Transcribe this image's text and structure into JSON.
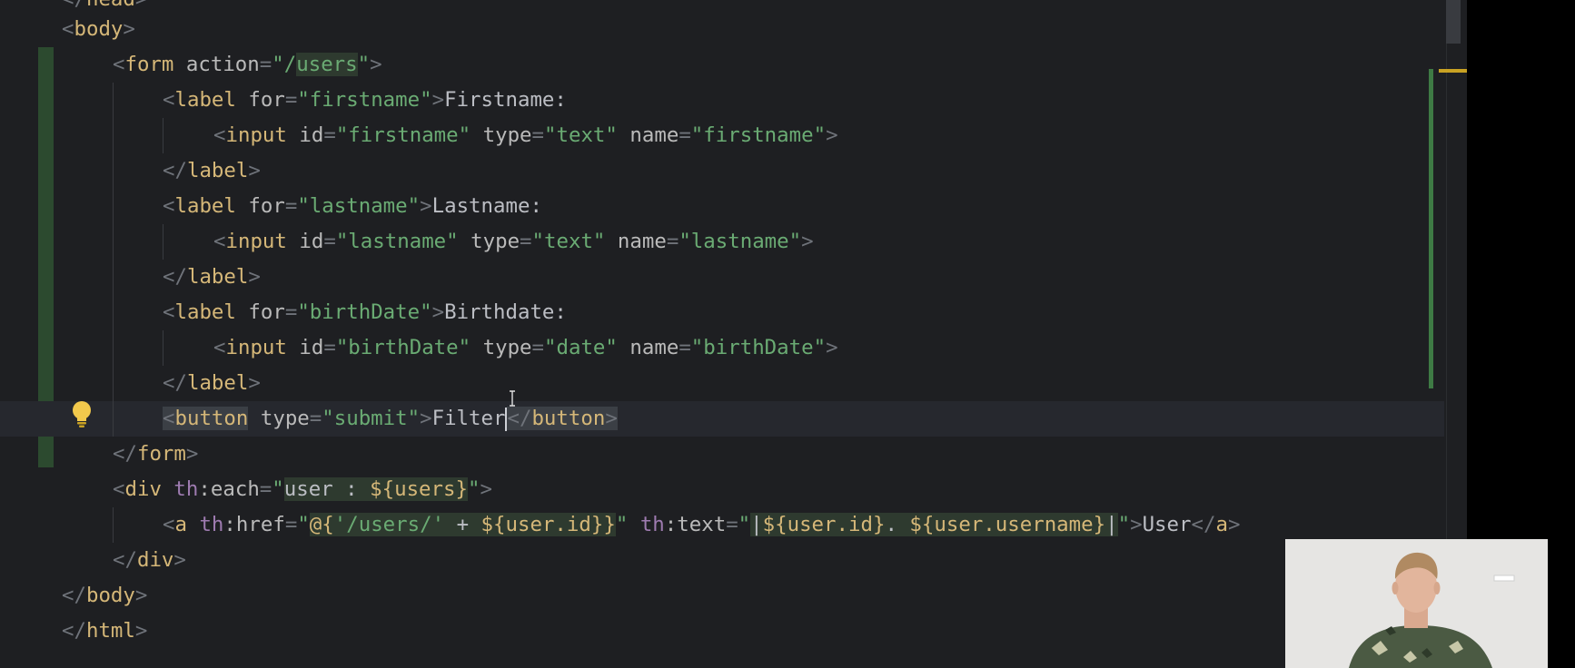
{
  "editor": {
    "language": "HTML (Thymeleaf)",
    "colors": {
      "background": "#1e1f22",
      "tag": "#d5b778",
      "attribute": "#bababa",
      "string": "#6aab73",
      "namespace": "#9e7bb0",
      "modified_gutter": "#2c4a2f",
      "bulb": "#f2c94c"
    },
    "lines": {
      "l0": "</head>",
      "l1_tag": "body",
      "l2": {
        "tag": "form",
        "attr": "action",
        "val_pre": "\"/",
        "val_hl": "users",
        "val_post": "\""
      },
      "l3": {
        "tag": "label",
        "attr": "for",
        "val": "\"firstname\"",
        "text": "Firstname:"
      },
      "l4": {
        "tag": "input",
        "a1": "id",
        "v1": "\"firstname\"",
        "a2": "type",
        "v2": "\"text\"",
        "a3": "name",
        "v3": "\"firstname\""
      },
      "l5_tag": "label",
      "l6": {
        "tag": "label",
        "attr": "for",
        "val": "\"lastname\"",
        "text": "Lastname:"
      },
      "l7": {
        "tag": "input",
        "a1": "id",
        "v1": "\"lastname\"",
        "a2": "type",
        "v2": "\"text\"",
        "a3": "name",
        "v3": "\"lastname\""
      },
      "l8_tag": "label",
      "l9": {
        "tag": "label",
        "attr": "for",
        "val": "\"birthDate\"",
        "text": "Birthdate:"
      },
      "l10": {
        "tag": "input",
        "a1": "id",
        "v1": "\"birthDate\"",
        "a2": "type",
        "v2": "\"date\"",
        "a3": "name",
        "v3": "\"birthDate\""
      },
      "l11_tag": "label",
      "l12": {
        "tag": "button",
        "attr": "type",
        "val": "\"submit\"",
        "text": "Filter",
        "close": "button"
      },
      "l13_tag": "form",
      "l14": {
        "tag": "div",
        "ns": "th",
        "attr": "each",
        "q1": "\"",
        "v_a": "user : ",
        "v_b": "${users}",
        "q2": "\""
      },
      "l15": {
        "tag": "a",
        "ns1": "th",
        "attr1": "href",
        "q1": "\"",
        "h_a": "@{",
        "h_b": "'/users/'",
        "h_c": " + ",
        "h_d": "${user.id}",
        "h_e": "}",
        "q2": "\"",
        "ns2": "th",
        "attr2": "text",
        "q3": "\"",
        "t_a": "|",
        "t_b": "${user.id}",
        "t_c": ". ",
        "t_d": "${user.username}",
        "t_e": "|",
        "q4": "\"",
        "text": "User",
        "close": "a"
      },
      "l16_tag": "div",
      "l17_tag": "body",
      "l18_tag": "html"
    }
  }
}
